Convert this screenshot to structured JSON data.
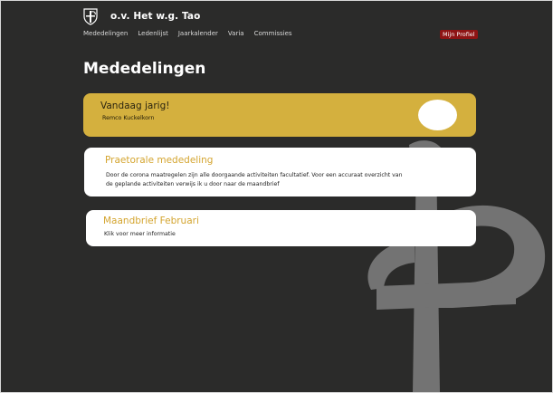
{
  "header": {
    "site_title": "o.v. Het w.g. Tao"
  },
  "nav": {
    "items": [
      "Mededelingen",
      "Ledenlijst",
      "Jaarkalender",
      "Varia",
      "Commissies"
    ],
    "profile_label": "Mijn Profiel"
  },
  "page": {
    "title": "Mededelingen"
  },
  "birthday_card": {
    "title": "Vandaag jarig!",
    "name": "Remco Kuckelkorn"
  },
  "announcements": [
    {
      "title": "Praetorale mededeling",
      "text_line1": "Door de corona maatregelen zijn alle doorgaande activiteiten facultatief. Voor een accuraat overzicht van",
      "text_line2": "de geplande activiteiten verwijs ik u door naar de maandbrief"
    },
    {
      "title": "Maandbrief Februari",
      "text_line1": "Klik voor meer informatie"
    }
  ],
  "colors": {
    "background": "#2b2b2a",
    "accent_gold": "#d4b03e",
    "title_gold": "#d4a530",
    "profile_red": "#8e1414",
    "watermark_gray": "#737373"
  }
}
